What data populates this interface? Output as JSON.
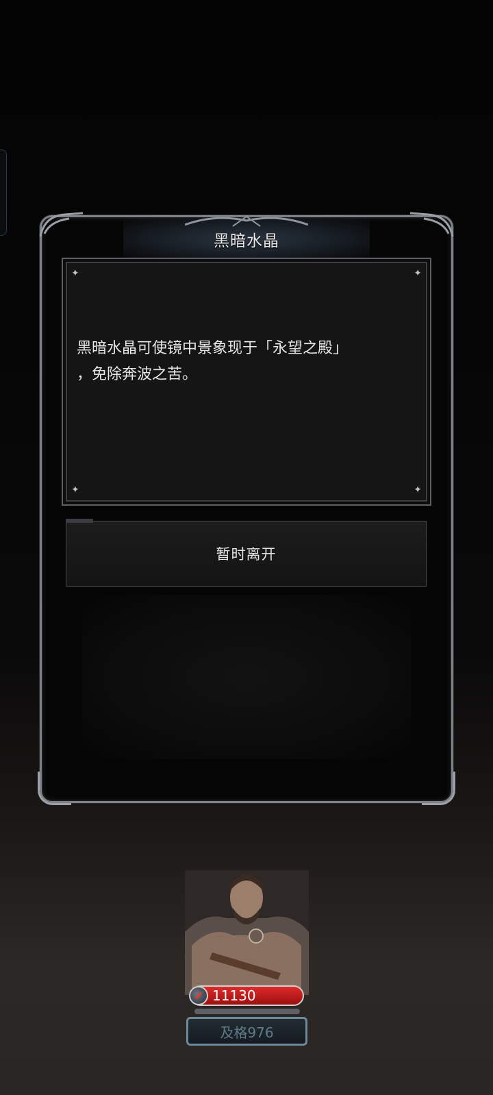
{
  "dialog": {
    "title": "黑暗水晶",
    "body_line1": "黑暗水晶可使镜中景象现于「永望之殿」",
    "body_line2": "，免除奔波之苦。",
    "leave_label": "暂时离开"
  },
  "hero": {
    "hp": "11130",
    "rank": "及格976",
    "hp_bar_color": "#c21c1c"
  },
  "icons": {
    "title_ornament": "metal-filigree-ornament",
    "panel_corners": "sparkle-star-icon",
    "hp_icon": "potion-icon"
  }
}
